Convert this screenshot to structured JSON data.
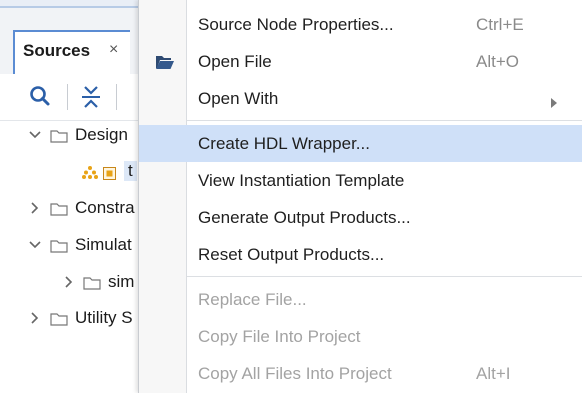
{
  "sources_panel": {
    "tab_label": "Sources",
    "tab_close": "×",
    "tree": [
      {
        "label": "Design",
        "expanded": true
      },
      {
        "label": "t",
        "selected": true
      },
      {
        "label": "Constra",
        "expanded": false
      },
      {
        "label": "Simulat",
        "expanded": true
      },
      {
        "label": "sim",
        "expanded": false
      },
      {
        "label": "Utility S",
        "expanded": false
      }
    ]
  },
  "context_menu": {
    "items": [
      {
        "label": "Source Node Properties...",
        "shortcut": "Ctrl+E"
      },
      {
        "label": "Open File",
        "shortcut": "Alt+O",
        "icon": "folder-open-icon"
      },
      {
        "label": "Open With",
        "submenu": true
      },
      {
        "label": "Create HDL Wrapper...",
        "highlighted": true
      },
      {
        "label": "View Instantiation Template"
      },
      {
        "label": "Generate Output Products..."
      },
      {
        "label": "Reset Output Products..."
      },
      {
        "label": "Replace File...",
        "disabled": true
      },
      {
        "label": "Copy File Into Project",
        "disabled": true
      },
      {
        "label": "Copy All Files Into Project",
        "shortcut": "Alt+I",
        "disabled": true
      }
    ]
  },
  "colors": {
    "highlight": "#cfe0f8",
    "tab_accent": "#5b8cd3",
    "disabled_text": "#a3a3a3",
    "block_design_icon": "#e8a317"
  }
}
